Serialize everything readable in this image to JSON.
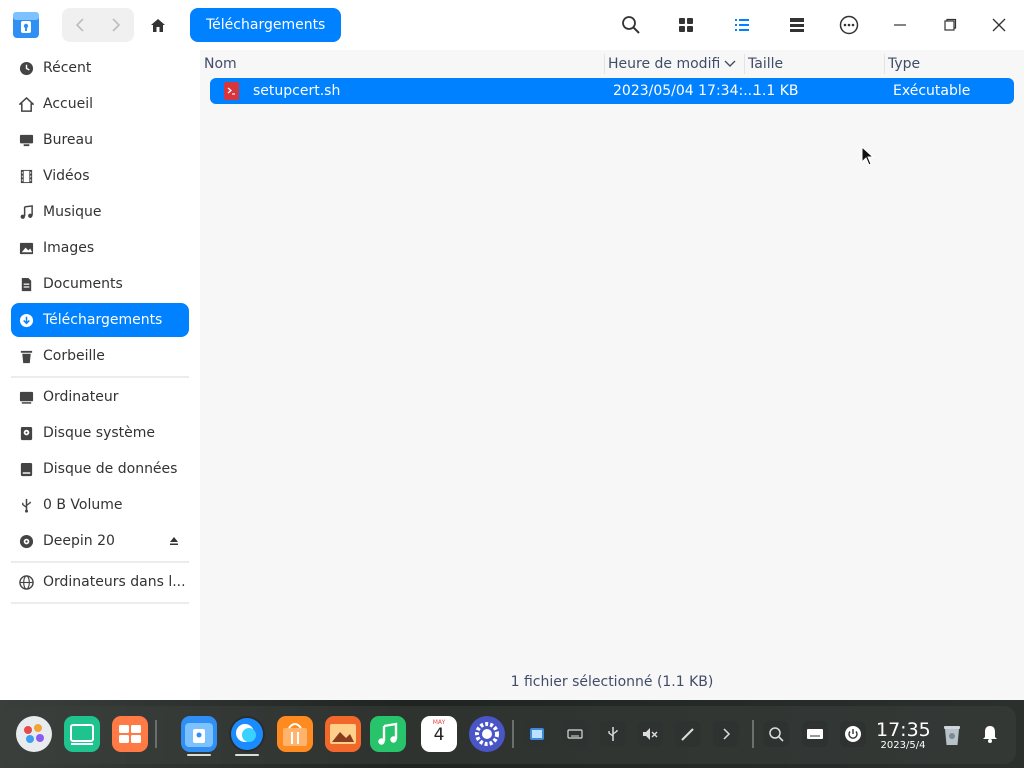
{
  "titlebar": {
    "breadcrumb": "Téléchargements"
  },
  "sidebar": {
    "items": [
      {
        "label": "Récent",
        "icon": "clock-icon"
      },
      {
        "label": "Accueil",
        "icon": "home-icon"
      },
      {
        "label": "Bureau",
        "icon": "desktop-icon"
      },
      {
        "label": "Vidéos",
        "icon": "video-icon"
      },
      {
        "label": "Musique",
        "icon": "music-icon"
      },
      {
        "label": "Images",
        "icon": "image-icon"
      },
      {
        "label": "Documents",
        "icon": "document-icon"
      },
      {
        "label": "Téléchargements",
        "icon": "download-icon"
      },
      {
        "label": "Corbeille",
        "icon": "trash-icon"
      },
      {
        "label": "Ordinateur",
        "icon": "computer-icon"
      },
      {
        "label": "Disque système",
        "icon": "disk-icon"
      },
      {
        "label": "Disque de données",
        "icon": "disk-icon"
      },
      {
        "label": "0 B Volume",
        "icon": "usb-icon"
      },
      {
        "label": "Deepin 20",
        "icon": "disc-icon"
      },
      {
        "label": "Ordinateurs dans l...",
        "icon": "network-icon"
      }
    ]
  },
  "columns": {
    "name": "Nom",
    "modified": "Heure de modific",
    "size": "Taille",
    "type": "Type"
  },
  "files": [
    {
      "name": "setupcert.sh",
      "modified": "2023/05/04 17:34:...",
      "size": "1.1 KB",
      "type": "Exécutable"
    }
  ],
  "status": "1 fichier sélectionné (1.1 KB)",
  "clock": {
    "time": "17:35",
    "date": "2023/5/4"
  },
  "calendar": {
    "month": "MAY",
    "day": "4"
  },
  "colors": {
    "accent": "#0081ff",
    "file_icon": "#d9353d"
  }
}
